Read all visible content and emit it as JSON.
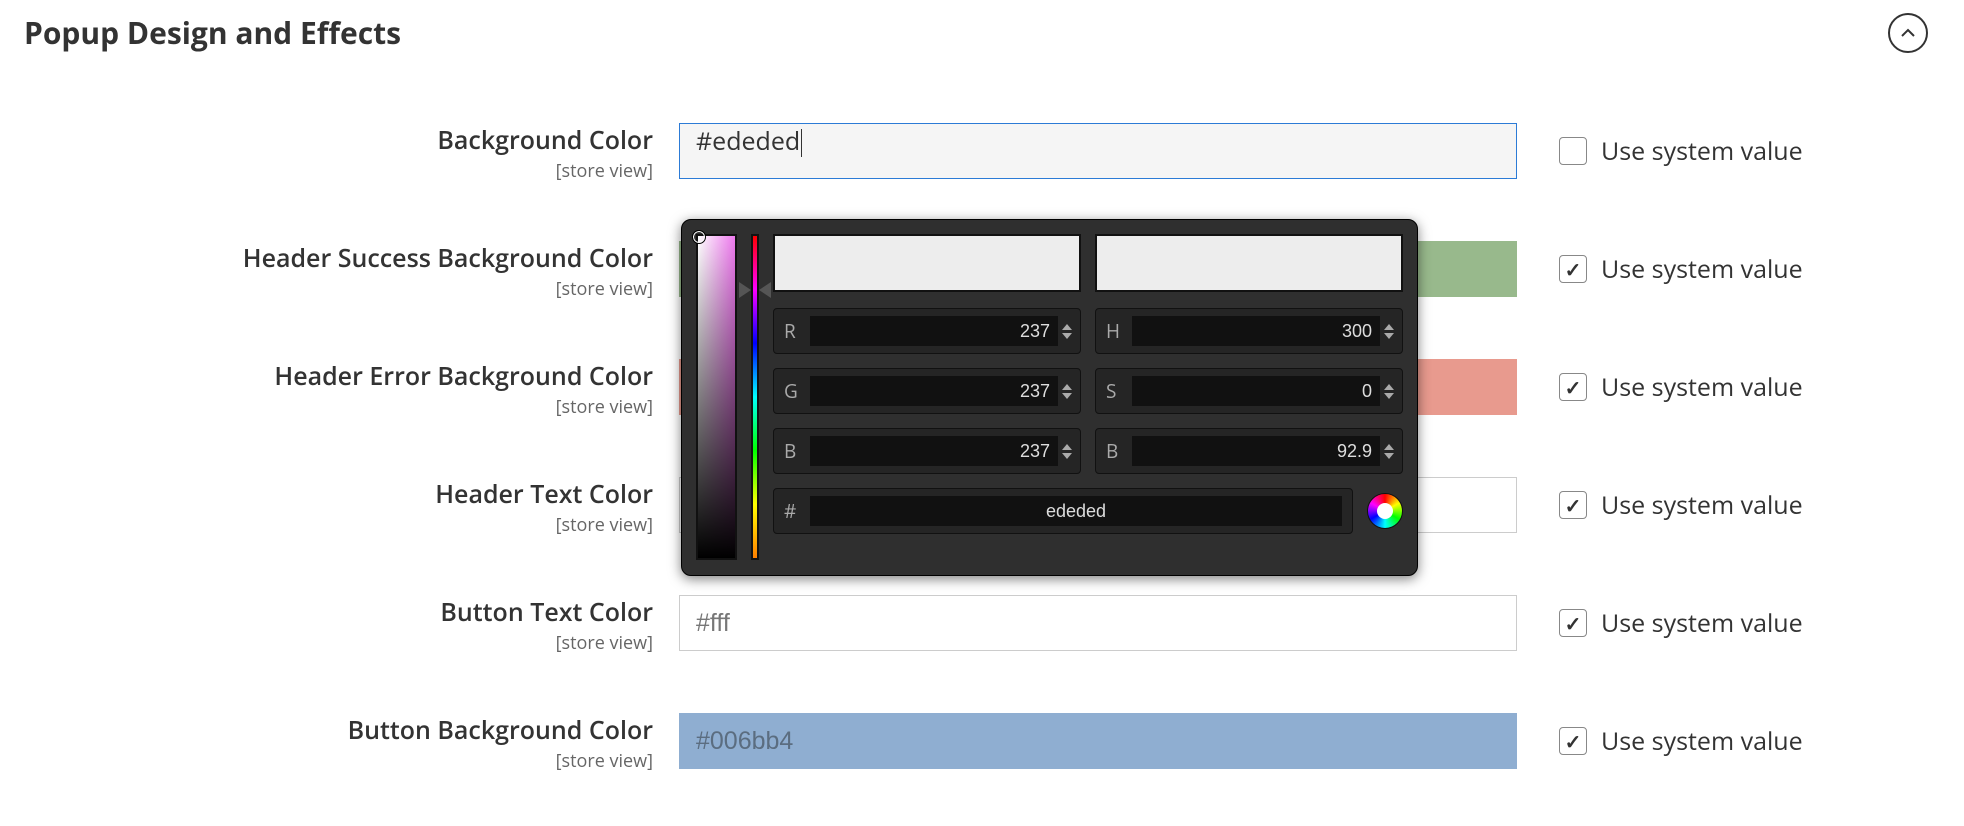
{
  "section": {
    "title": "Popup Design and Effects",
    "collapsed": false
  },
  "scope_label": "[store view]",
  "system_value_label": "Use system value",
  "fields": {
    "bg_color": {
      "label": "Background Color",
      "value": "#ededed",
      "use_system": false
    },
    "header_success_bg": {
      "label": "Header Success Background Color",
      "value": "",
      "swatch": "#98b98c",
      "use_system": true
    },
    "header_error_bg": {
      "label": "Header Error Background Color",
      "value": "",
      "swatch": "#e89a8e",
      "use_system": true
    },
    "header_text_color": {
      "label": "Header Text Color",
      "value": "",
      "use_system": true
    },
    "button_text_color": {
      "label": "Button Text Color",
      "value": "#fff",
      "use_system": true
    },
    "button_bg_color": {
      "label": "Button Background Color",
      "value": "#006bb4",
      "swatch": "#8faed1",
      "use_system": true
    }
  },
  "color_picker": {
    "current_swatch": "#ededed",
    "previous_swatch": "#ededed",
    "rgb": {
      "r": "237",
      "g": "237",
      "b": "237"
    },
    "hsb": {
      "h": "300",
      "s": "0",
      "b": "92.9"
    },
    "hex": "ededed",
    "labels": {
      "r": "R",
      "g": "G",
      "b_rgb": "B",
      "h": "H",
      "s": "S",
      "b_hsb": "B",
      "hex": "#"
    }
  }
}
